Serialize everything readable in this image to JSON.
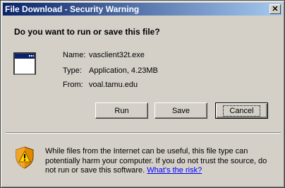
{
  "window": {
    "title": "File Download - Security Warning",
    "close_label": "✕"
  },
  "question": "Do you want to run or save this file?",
  "file": {
    "name_label": "Name:",
    "name_value": "vasclient32t.exe",
    "type_label": "Type:",
    "type_value": "Application, 4.23MB",
    "from_label": "From:",
    "from_value": "voal.tamu.edu"
  },
  "buttons": {
    "run": "Run",
    "save": "Save",
    "cancel": "Cancel"
  },
  "warning": {
    "text": "While files from the Internet can be useful, this file type can potentially harm your computer. If you do not trust the source, do not run or save this software. ",
    "link": "What's the risk?"
  },
  "icons": {
    "file": "application-window-icon",
    "warning": "security-shield-warning-icon"
  },
  "colors": {
    "titlebar_start": "#0a246a",
    "titlebar_end": "#a6caf0",
    "dialog_bg": "#d4d0c8",
    "link": "#0000ff"
  }
}
